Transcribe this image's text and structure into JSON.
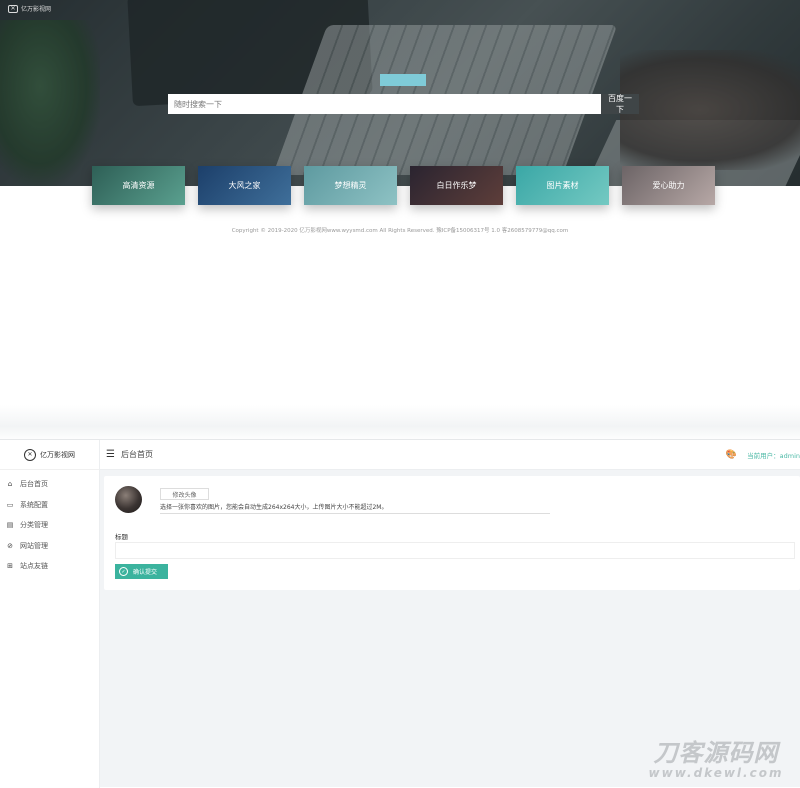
{
  "hero": {
    "logo_text": "亿万影视网",
    "search_placeholder": "随时搜索一下",
    "search_button": "百度一下"
  },
  "cards": [
    {
      "label": "高清资源",
      "color_from": "#2e5f56",
      "color_to": "#5aa08f"
    },
    {
      "label": "大风之家",
      "color_from": "#1c3f6a",
      "color_to": "#3f6f9a"
    },
    {
      "label": "梦想精灵",
      "color_from": "#5e9aa0",
      "color_to": "#8ec2c4"
    },
    {
      "label": "白日作乐梦",
      "color_from": "#2a2430",
      "color_to": "#5e3e3a"
    },
    {
      "label": "图片素材",
      "color_from": "#3aa7a6",
      "color_to": "#74c9c2"
    },
    {
      "label": "爱心助力",
      "color_from": "#6c6466",
      "color_to": "#b7a8a6"
    }
  ],
  "footer": {
    "copyright": "Copyright © 2019-2020 亿万影视网www.wyysmd.com All Rights Reserved. 豫ICP备15006317号 1.0 客2608579779@qq.com"
  },
  "admin": {
    "logo_text": "亿万影视网",
    "sidebar": [
      {
        "icon": "⌂",
        "icon_name": "home-icon",
        "label": "后台首页"
      },
      {
        "icon": "▭",
        "icon_name": "monitor-icon",
        "label": "系统配置"
      },
      {
        "icon": "▤",
        "icon_name": "list-icon",
        "label": "分类管理"
      },
      {
        "icon": "⊘",
        "icon_name": "compass-icon",
        "label": "网站管理"
      },
      {
        "icon": "⊞",
        "icon_name": "grid-icon",
        "label": "站点友链"
      }
    ],
    "topbar": {
      "title": "后台首页",
      "user_text": "当前用户：admin"
    },
    "panel": {
      "avatar_button": "修改头像",
      "avatar_tip": "选择一张你喜欢的图片，您能会自动生成264x264大小，上传图片大小不能超过2M。",
      "field_label": "标题",
      "field_value": "",
      "submit_label": "确认提交"
    }
  },
  "watermark": {
    "line1": "刀客源码网",
    "line2": "www.dkewl.com"
  }
}
